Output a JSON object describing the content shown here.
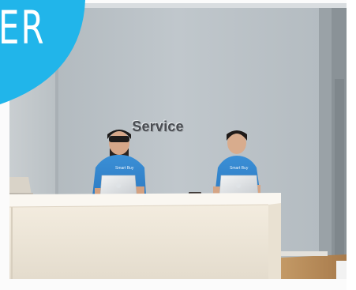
{
  "badge": {
    "text": "ER",
    "color": "#21b5ea"
  },
  "wall_sign": {
    "text": "Service"
  },
  "shirt_print": {
    "left": "Smart Buy",
    "right": "Smart Buy"
  }
}
